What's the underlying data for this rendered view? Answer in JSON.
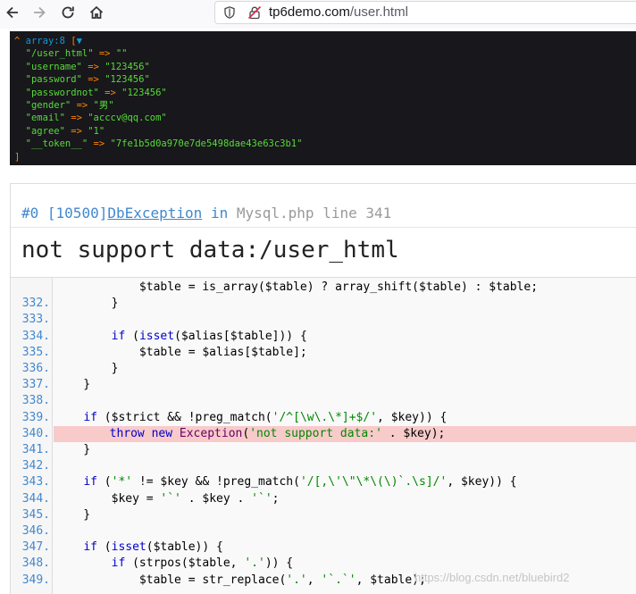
{
  "browser": {
    "url_host": "tp6demo.com",
    "url_path": "/user.html"
  },
  "dump": {
    "header_caret": "^",
    "header_type": "array:8",
    "header_open": "[",
    "header_toggle": "▼",
    "entries": [
      {
        "key": "\"/user_html\"",
        "value": "\"\""
      },
      {
        "key": "\"username\"",
        "value": "\"123456\""
      },
      {
        "key": "\"password\"",
        "value": "\"123456\""
      },
      {
        "key": "\"passwordnot\"",
        "value": "\"123456\""
      },
      {
        "key": "\"gender\"",
        "value": "\"男\""
      },
      {
        "key": "\"email\"",
        "value": "\"acccv@qq.com\""
      },
      {
        "key": "\"agree\"",
        "value": "\"1\""
      },
      {
        "key": "\"__token__\"",
        "value": "\"7fe1b5d0a970e7de5498dae43e63c3b1\""
      }
    ],
    "arrow": "=>",
    "footer": "]"
  },
  "exception": {
    "index": "#0",
    "code": "[10500]",
    "class": "DbException",
    "in_word": "in",
    "file": "Mysql.php",
    "line_word": "line",
    "line": "341",
    "message": "not support data:/user_html"
  },
  "code_lines": [
    {
      "num": "",
      "text": "            $table = is_array($table) ? array_shift($table) : $table;"
    },
    {
      "num": "332.",
      "text": "        }"
    },
    {
      "num": "333.",
      "text": ""
    },
    {
      "num": "334.",
      "text": "        if (isset($alias[$table])) {"
    },
    {
      "num": "335.",
      "text": "            $table = $alias[$table];"
    },
    {
      "num": "336.",
      "text": "        }"
    },
    {
      "num": "337.",
      "text": "    }"
    },
    {
      "num": "338.",
      "text": ""
    },
    {
      "num": "339.",
      "text": "    if ($strict && !preg_match('/^[\\w\\.\\*]+$/', $key)) {"
    },
    {
      "num": "340.",
      "text": "        throw new Exception('not support data:' . $key);"
    },
    {
      "num": "341.",
      "text": "    }"
    },
    {
      "num": "342.",
      "text": ""
    },
    {
      "num": "343.",
      "text": "    if ('*' != $key && !preg_match('/[,\\'\\\"\\*\\(\\)`.\\s]/', $key)) {"
    },
    {
      "num": "344.",
      "text": "        $key = '`' . $key . '`';"
    },
    {
      "num": "345.",
      "text": "    }"
    },
    {
      "num": "346.",
      "text": ""
    },
    {
      "num": "347.",
      "text": "    if (isset($table)) {"
    },
    {
      "num": "348.",
      "text": "        if (strpos($table, '.')) {"
    },
    {
      "num": "349.",
      "text": "            $table = str_replace('.', '`.`', $table);"
    }
  ],
  "highlight_line": "340.",
  "watermark": "https://blog.csdn.net/bluebird2",
  "icons": [
    "back-arrow-icon",
    "forward-arrow-icon",
    "reload-icon",
    "home-icon",
    "shield-icon",
    "insecure-lock-icon"
  ]
}
